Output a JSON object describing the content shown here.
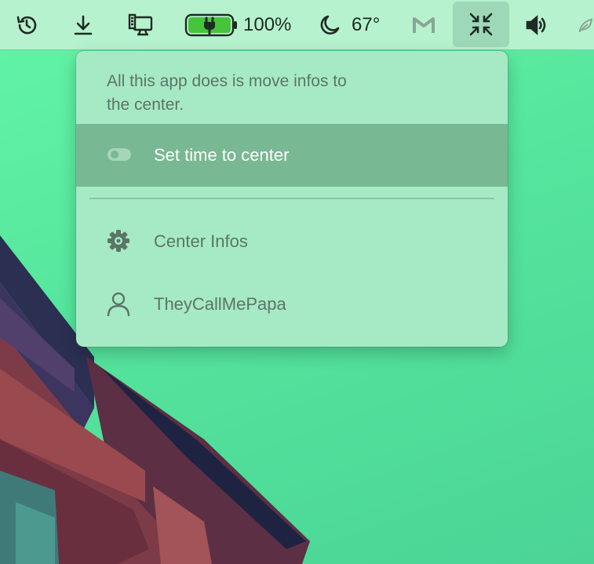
{
  "menubar": {
    "battery": {
      "percent_label": "100%",
      "level": 1.0,
      "charging": true,
      "fill_color": "#46c43c"
    },
    "weather": {
      "temperature": "67°"
    },
    "icons": [
      "history-icon",
      "download-icon",
      "monitor-icon",
      "battery-icon",
      "moon-icon",
      "gmail-icon",
      "collapse-arrows-icon",
      "speaker-icon",
      "leaf-icon"
    ]
  },
  "dropdown": {
    "description": "All this app does is move infos to the center.",
    "items": [
      {
        "label": "Set time to center",
        "icon": "toggle-switch-icon",
        "toggle_on": false,
        "highlighted": true
      },
      {
        "label": "Center Infos",
        "icon": "gear-icon"
      },
      {
        "label": "TheyCallMePapa",
        "icon": "user-icon"
      }
    ]
  },
  "colors": {
    "menubar_bg": "#b7f2cf",
    "dropdown_bg": "#a6eac5",
    "highlight_bg": "#78b893",
    "desktop_green": "#55e59d"
  }
}
